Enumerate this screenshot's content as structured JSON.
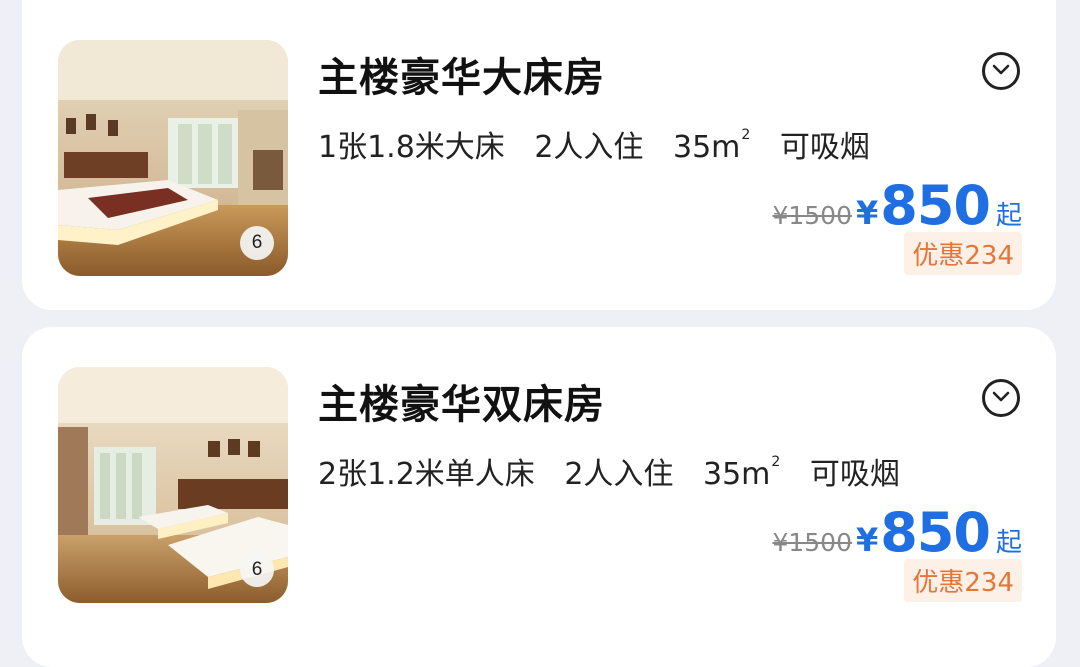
{
  "rooms": [
    {
      "title": "主楼豪华大床房",
      "features": {
        "bed": "1张1.8米大床",
        "guests": "2人入住",
        "area": "35m",
        "area_sup": "2",
        "smoking": "可吸烟"
      },
      "photo_count": "6",
      "original_price": "¥1500",
      "currency": "¥",
      "price": "850",
      "price_suffix": "起",
      "discount": "优惠234"
    },
    {
      "title": "主楼豪华双床房",
      "features": {
        "bed": "2张1.2米单人床",
        "guests": "2人入住",
        "area": "35m",
        "area_sup": "2",
        "smoking": "可吸烟"
      },
      "photo_count": "6",
      "original_price": "¥1500",
      "currency": "¥",
      "price": "850",
      "price_suffix": "起",
      "discount": "优惠234"
    }
  ],
  "colors": {
    "accent": "#1f6fe3",
    "discount_text": "#e4763a",
    "discount_bg": "#fdf0e6",
    "background": "#eef0f5"
  },
  "icons": {
    "expand": "chevron-down-circle-icon"
  }
}
